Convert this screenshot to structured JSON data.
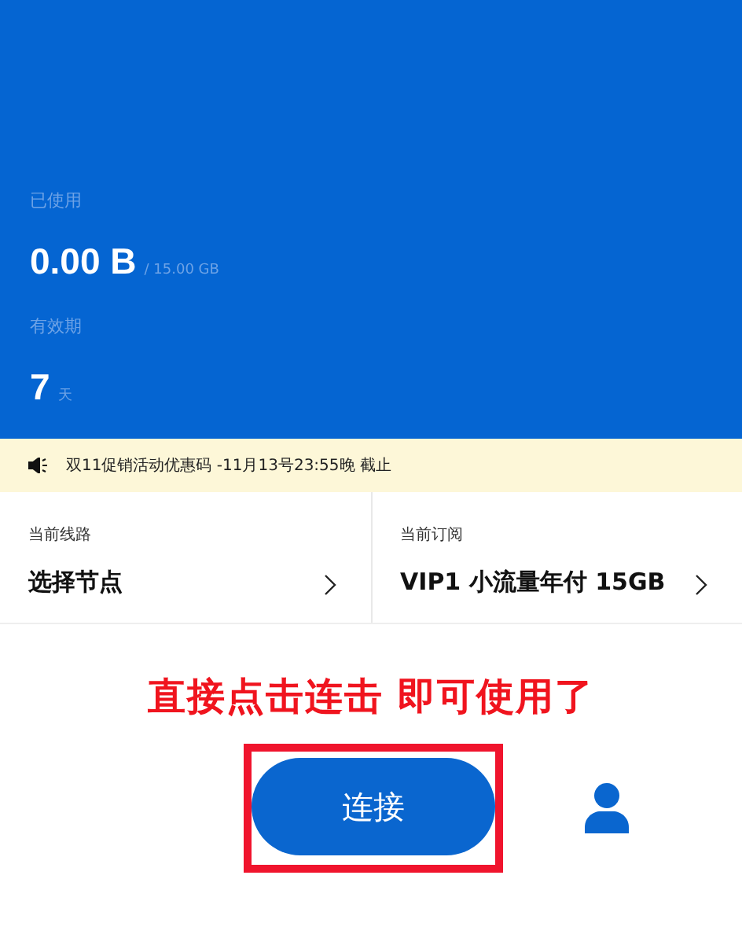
{
  "usage": {
    "used_label": "已使用",
    "used_value": "0.00 B",
    "quota": "/ 15.00 GB",
    "validity_label": "有效期",
    "validity_value": "7",
    "validity_unit": "天"
  },
  "notice": {
    "text": "双11促销活动优惠码 -11月13号23:55晚 截止"
  },
  "cards": [
    {
      "label": "当前线路",
      "value": "选择节点"
    },
    {
      "label": "当前订阅",
      "value": "VIP1 小流量年付 15GB"
    }
  ],
  "annotation": {
    "text": "直接点击连击 即可使用了",
    "highlighted": true
  },
  "connect_button": {
    "label": "连接"
  }
}
